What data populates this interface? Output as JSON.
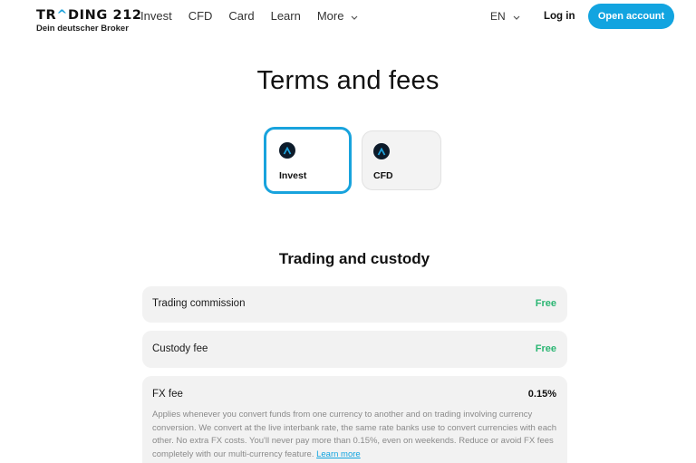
{
  "nav": {
    "logo_part1": "TR",
    "logo_accent": "^",
    "logo_part2": "DING 212",
    "logo_tagline": "Dein deutscher Broker",
    "items": [
      {
        "label": "Invest"
      },
      {
        "label": "CFD"
      },
      {
        "label": "Card"
      },
      {
        "label": "Learn"
      },
      {
        "label": "More"
      }
    ],
    "language": "EN",
    "login_label": "Log in",
    "open_account_label": "Open account",
    "accent_color": "#12a4e0"
  },
  "page": {
    "title": "Terms and fees"
  },
  "tiles": [
    {
      "label": "Invest",
      "selected": true
    },
    {
      "label": "CFD",
      "selected": false
    }
  ],
  "section": {
    "title": "Trading and custody",
    "rows": [
      {
        "label": "Trading commission",
        "value": "Free"
      },
      {
        "label": "Custody fee",
        "value": "Free"
      },
      {
        "label": "FX fee",
        "value": "0.15%",
        "description": "Applies whenever you convert funds from one currency to another and on trading involving currency conversion. We convert at the live interbank rate, the same rate banks use to convert currencies with each other. No extra FX costs. You'll never pay more than 0.15%, even on weekends. Reduce or avoid FX fees completely with our multi-currency feature.",
        "link_label": "Learn more"
      }
    ]
  }
}
